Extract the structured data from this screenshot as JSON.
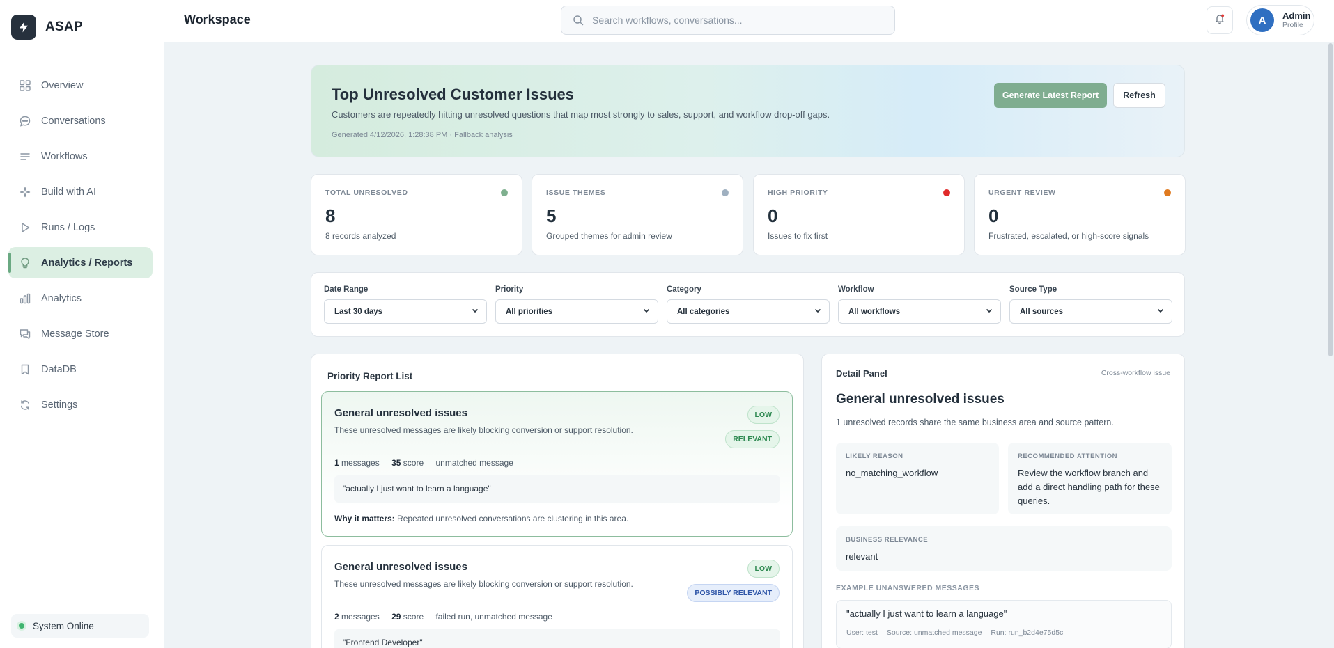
{
  "brand": {
    "name": "ASAP"
  },
  "sidebar": {
    "items": [
      {
        "label": "Overview",
        "icon": "grid-icon",
        "active": false
      },
      {
        "label": "Conversations",
        "icon": "chat-bubble-icon",
        "active": false
      },
      {
        "label": "Workflows",
        "icon": "lines-icon",
        "active": false
      },
      {
        "label": "Build with AI",
        "icon": "sparkle-icon",
        "active": false
      },
      {
        "label": "Runs / Logs",
        "icon": "play-icon",
        "active": false
      },
      {
        "label": "Analytics / Reports",
        "icon": "lightbulb-icon",
        "active": true
      },
      {
        "label": "Analytics",
        "icon": "bar-chart-icon",
        "active": false
      },
      {
        "label": "Message Store",
        "icon": "messages-icon",
        "active": false
      },
      {
        "label": "DataDB",
        "icon": "bookmark-icon",
        "active": false
      },
      {
        "label": "Settings",
        "icon": "refresh-gear-icon",
        "active": false
      }
    ],
    "status": "System Online"
  },
  "topbar": {
    "title": "Workspace",
    "search_placeholder": "Search workflows, conversations...",
    "user_initial": "A",
    "user_name": "Admin",
    "user_sub": "Profile"
  },
  "hero": {
    "title": "Top Unresolved Customer Issues",
    "description": "Customers are repeatedly hitting unresolved questions that map most strongly to sales, support, and workflow drop-off gaps.",
    "meta": "Generated 4/12/2026, 1:28:38 PM · Fallback analysis",
    "primary_button": "Generate Latest Report",
    "secondary_button": "Refresh"
  },
  "stats": [
    {
      "label": "TOTAL UNRESOLVED",
      "value": "8",
      "sub": "8 records analyzed",
      "color": "#7fb08f"
    },
    {
      "label": "ISSUE THEMES",
      "value": "5",
      "sub": "Grouped themes for admin review",
      "color": "#9fb0c0"
    },
    {
      "label": "HIGH PRIORITY",
      "value": "0",
      "sub": "Issues to fix first",
      "color": "#e02b2b"
    },
    {
      "label": "URGENT REVIEW",
      "value": "0",
      "sub": "Frustrated, escalated, or high-score signals",
      "color": "#e07a1f"
    }
  ],
  "filters": [
    {
      "label": "Date Range",
      "value": "Last 30 days"
    },
    {
      "label": "Priority",
      "value": "All priorities"
    },
    {
      "label": "Category",
      "value": "All categories"
    },
    {
      "label": "Workflow",
      "value": "All workflows"
    },
    {
      "label": "Source Type",
      "value": "All sources"
    }
  ],
  "report_list": {
    "title": "Priority Report List",
    "cards": [
      {
        "title": "General unresolved issues",
        "description": "These unresolved messages are likely blocking conversion or support resolution.",
        "priority": "LOW",
        "relevance": "RELEVANT",
        "messages": "1",
        "messages_label": "messages",
        "score": "35",
        "score_label": "score",
        "source": "unmatched message",
        "quote": "\"actually I just want to learn a language\"",
        "why_label": "Why it matters:",
        "why": "Repeated unresolved conversations are clustering in this area."
      },
      {
        "title": "General unresolved issues",
        "description": "These unresolved messages are likely blocking conversion or support resolution.",
        "priority": "LOW",
        "relevance": "POSSIBLY RELEVANT",
        "messages": "2",
        "messages_label": "messages",
        "score": "29",
        "score_label": "score",
        "source": "failed run, unmatched message",
        "quote": "\"Frontend Developer\""
      }
    ]
  },
  "detail": {
    "label": "Detail Panel",
    "tag": "Cross-workflow issue",
    "title": "General unresolved issues",
    "description": "1 unresolved records share the same business area and source pattern.",
    "likely_reason_label": "LIKELY REASON",
    "likely_reason": "no_matching_workflow",
    "recommended_label": "RECOMMENDED ATTENTION",
    "recommended": "Review the workflow branch and add a direct handling path for these queries.",
    "relevance_label": "BUSINESS RELEVANCE",
    "relevance": "relevant",
    "examples_label": "EXAMPLE UNANSWERED MESSAGES",
    "example_text": "\"actually I just want to learn a language\"",
    "example_user": "User: test",
    "example_source": "Source: unmatched message",
    "example_run": "Run: run_b2d4e75d5c"
  }
}
